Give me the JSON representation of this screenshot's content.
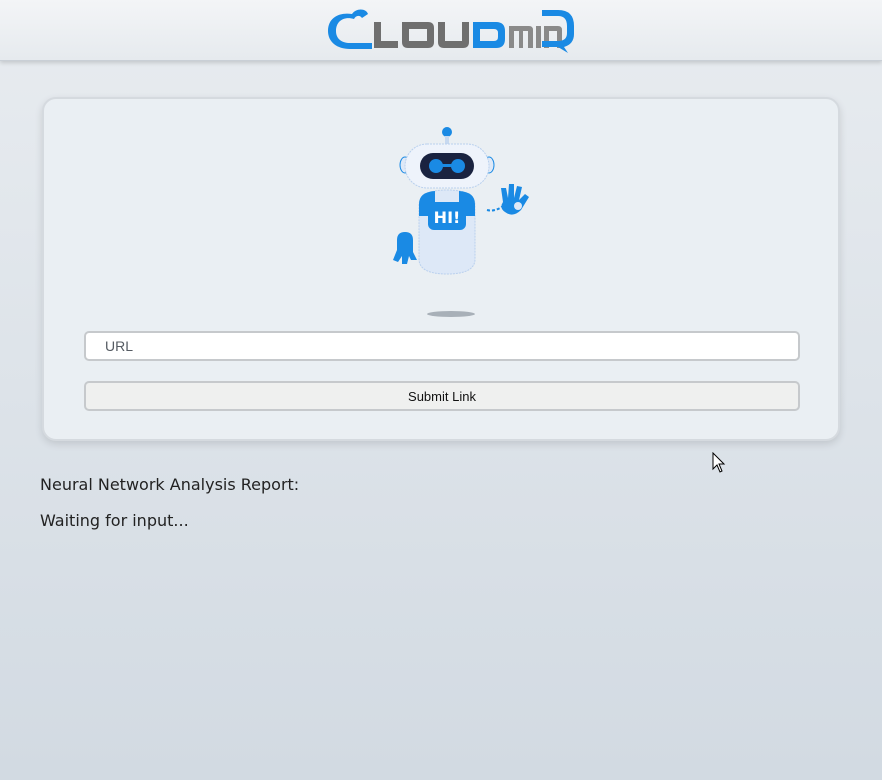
{
  "header": {
    "logo_text": "CLOUD MIND"
  },
  "robot": {
    "badge_text": "HI!"
  },
  "form": {
    "url_placeholder": "URL",
    "url_value": "",
    "submit_label": "Submit Link"
  },
  "report": {
    "title": "Neural Network Analysis Report:",
    "status": "Waiting for input..."
  },
  "colors": {
    "brand_blue": "#1a8ae4",
    "brand_gray": "#6f6f6f",
    "card_bg": "#eaeff3"
  }
}
